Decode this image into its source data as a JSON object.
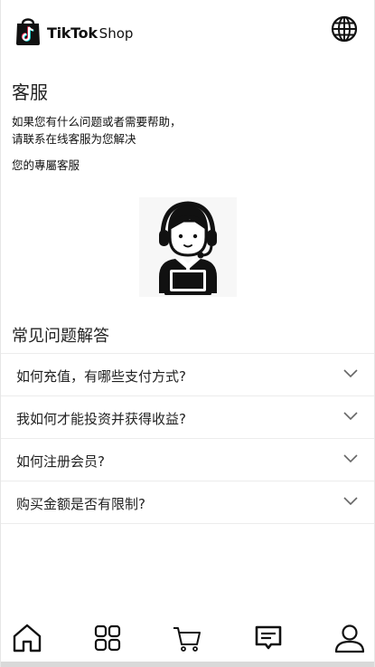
{
  "header": {
    "brand": "TikTok",
    "shop": "Shop",
    "logo_icon": "tiktok-shop-bag-logo",
    "language_icon": "globe-icon"
  },
  "service": {
    "title": "客服",
    "description_line1": "如果您有什么问题或者需要帮助，",
    "description_line2": "请联系在线客服为您解决",
    "dedicated_label": "您的專屬客服",
    "agent_icon": "customer-service-agent-icon"
  },
  "faq": {
    "title": "常见问题解答",
    "items": [
      {
        "question": "如何充值，有哪些支付方式?"
      },
      {
        "question": "我如何才能投资并获得收益?"
      },
      {
        "question": "如何注册会员?"
      },
      {
        "question": "购买金额是否有限制?"
      }
    ],
    "expand_icon": "chevron-down-icon"
  },
  "nav": {
    "items": [
      {
        "name": "home",
        "icon": "home-icon",
        "active": false
      },
      {
        "name": "categories",
        "icon": "grid-icon",
        "active": false
      },
      {
        "name": "cart",
        "icon": "cart-icon",
        "active": false
      },
      {
        "name": "messages",
        "icon": "message-icon",
        "active": true
      },
      {
        "name": "profile",
        "icon": "user-icon",
        "active": false
      }
    ]
  },
  "colors": {
    "text": "#111111",
    "divider": "#ececec",
    "chevron": "#666666",
    "tiktok_cyan": "#25f4ee",
    "tiktok_red": "#fe2c55"
  }
}
